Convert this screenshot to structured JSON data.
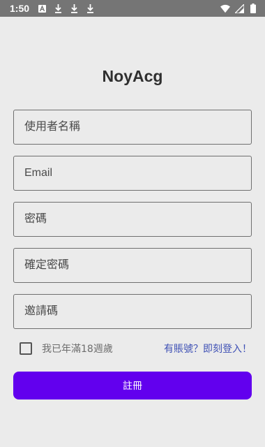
{
  "status_bar": {
    "time": "1:50",
    "left_icons": [
      "notification-a-icon",
      "download-icon",
      "download-icon",
      "download-icon"
    ],
    "right_icons": [
      "wifi-icon",
      "signal-icon",
      "battery-icon"
    ]
  },
  "app": {
    "title": "NoyAcg"
  },
  "form": {
    "username_placeholder": "使用者名稱",
    "email_placeholder": "Email",
    "password_placeholder": "密碼",
    "confirm_password_placeholder": "確定密碼",
    "invite_code_placeholder": "邀請碼",
    "age_checkbox_label": "我已年滿18週歲",
    "age_checked": false,
    "login_link": "有賬號？即刻登入！",
    "register_button": "註冊"
  },
  "colors": {
    "accent": "#6200ee",
    "link": "#3f51b5",
    "background": "#ebebeb",
    "status_bar": "#757575"
  }
}
